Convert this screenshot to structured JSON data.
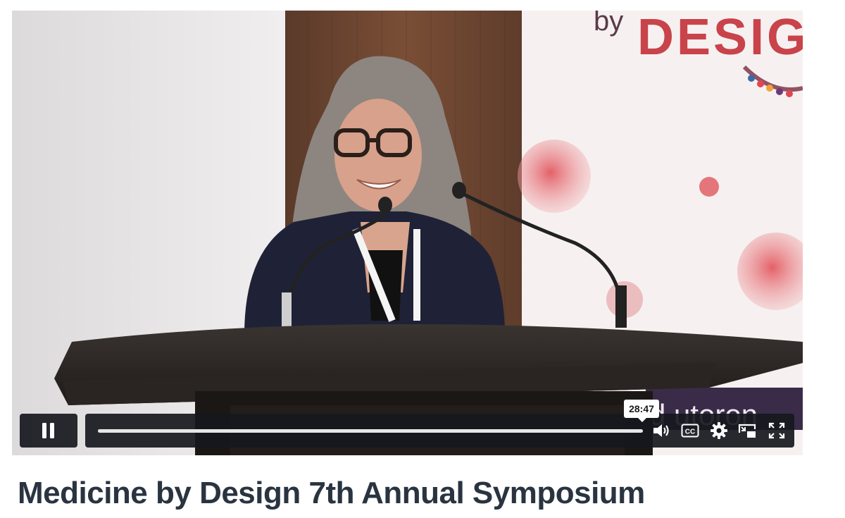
{
  "player": {
    "time_tooltip": "28:47",
    "progress_fraction": 1.0,
    "controls": {
      "play_pause": "pause-icon",
      "volume": "volume-icon",
      "captions": "cc-icon",
      "captions_label": "CC",
      "settings": "gear-icon",
      "pip": "picture-in-picture-icon",
      "fullscreen": "fullscreen-icon"
    },
    "colors": {
      "control_bg": "#16181e",
      "accent": "#ffffff",
      "banner_red": "#c9434a"
    }
  },
  "banner": {
    "text_by": "by",
    "text_brand": "DESIG",
    "text_lower": "d utoron"
  },
  "page": {
    "title": "Medicine by Design 7th Annual Symposium"
  }
}
